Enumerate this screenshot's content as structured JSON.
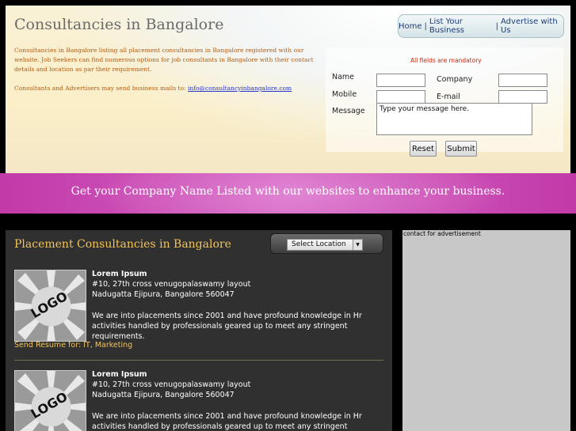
{
  "header": {
    "site_title": "Consultancies in Bangalore",
    "nav": [
      "Home",
      "List Your Business",
      "Advertise with Us"
    ],
    "nav_sep": "|",
    "intro_p1": "Consultancies in Bangalore listing all placement consultancies in Bangalore registered with our website. Job Seekers can find numerous options for job consultants in Bangalore with their contact details and location as par their requirement.",
    "intro_p2_prefix": "Consultants and Advertisers may send business mails to: ",
    "intro_email": "info@consultancyinbangalore.com"
  },
  "form": {
    "mandatory_note": "All fields are mandatory",
    "name_label": "Name",
    "company_label": "Company",
    "mobile_label": "Mobile",
    "email_label": "E-mail",
    "message_label": "Message",
    "message_value": "Type your message here.",
    "reset_label": "Reset",
    "submit_label": "Submit"
  },
  "banner": {
    "text": "Get your Company Name Listed with our websites to enhance your business."
  },
  "main": {
    "section_title": "Placement Consultancies in Bangalore",
    "location_select": "Select Location",
    "listings": [
      {
        "logo_text": "LOGO",
        "name": "Lorem Ipsum",
        "address1": "#10, 27th cross venugopalaswamy layout",
        "address2": "Nadugatta Ejipura, Bangalore 560047",
        "description": "We are into placements since 2001 and have profound knowledge in Hr activities handled by professionals geared up to meet any stringent requirements.",
        "resume": "Send Resume for: IT, Marketing"
      },
      {
        "logo_text": "LOGO",
        "name": "Lorem Ipsum",
        "address1": "#10, 27th cross venugopalaswamy layout",
        "address2": "Nadugatta Ejipura, Bangalore 560047",
        "description": "We are into placements since 2001 and have profound knowledge in Hr activities handled by professionals geared up to meet any stringent requirements."
      }
    ]
  },
  "sidebar": {
    "ad_label": "contact for advertisement"
  }
}
